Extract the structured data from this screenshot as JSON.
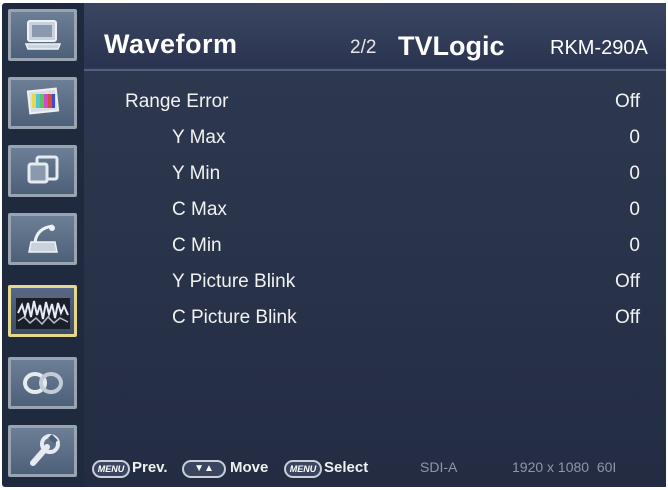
{
  "sidebar": {
    "tiles": [
      {
        "icon": "monitor-icon",
        "active": false
      },
      {
        "icon": "color-bars-icon",
        "active": false
      },
      {
        "icon": "windows-icon",
        "active": false
      },
      {
        "icon": "satellite-dish-icon",
        "active": false
      },
      {
        "icon": "waveform-icon",
        "active": true
      },
      {
        "icon": "link-icon",
        "active": false
      },
      {
        "icon": "wrench-icon",
        "active": false
      }
    ]
  },
  "header": {
    "title": "Waveform",
    "page": "2/2",
    "brand": "TVLogic",
    "model": "RKM-290A"
  },
  "menu": {
    "items": [
      {
        "label": "Range Error",
        "value": "Off"
      },
      {
        "label": "Y Max",
        "value": "0"
      },
      {
        "label": "Y Min",
        "value": "0"
      },
      {
        "label": "C Max",
        "value": "0"
      },
      {
        "label": "C Min",
        "value": "0"
      },
      {
        "label": "Y Picture Blink",
        "value": "Off"
      },
      {
        "label": "C Picture Blink",
        "value": "Off"
      }
    ]
  },
  "footer": {
    "menu_key": "MENU",
    "prev_label": "Prev.",
    "arrows_key": "▼▲",
    "move_label": "Move",
    "select_key": "MENU",
    "select_label": "Select",
    "input": "SDI-A",
    "format": "1920 x 1080  60I"
  },
  "colors": {
    "background": "#1f2a3f",
    "panel": "#2a3450",
    "active_tile_border": "#e6d88a",
    "text": "#ffffff"
  }
}
